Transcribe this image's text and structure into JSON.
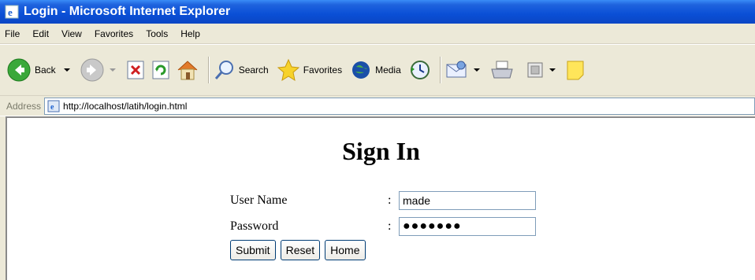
{
  "window": {
    "title": "Login - Microsoft Internet Explorer"
  },
  "menu": [
    "File",
    "Edit",
    "View",
    "Favorites",
    "Tools",
    "Help"
  ],
  "toolbar": {
    "back": "Back",
    "search": "Search",
    "favorites": "Favorites",
    "media": "Media"
  },
  "address": {
    "label": "Address",
    "url": "http://localhost/latih/login.html"
  },
  "page": {
    "heading": "Sign In",
    "username_label": "User Name",
    "password_label": "Password",
    "colon": ":",
    "username_value": "made",
    "password_masked": "●●●●●●●",
    "submit": "Submit",
    "reset": "Reset",
    "home": "Home"
  }
}
